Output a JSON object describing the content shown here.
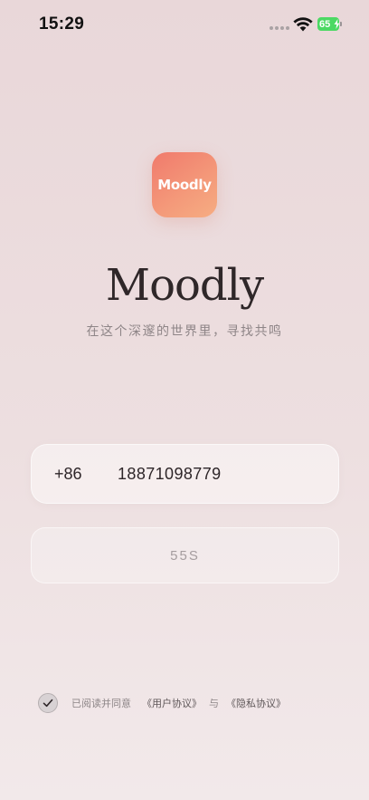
{
  "status_bar": {
    "time": "15:29",
    "battery_level": "65"
  },
  "app": {
    "icon_text": "Moodly",
    "title": "Moodly",
    "slogan": "在这个深邃的世界里，寻找共鸣"
  },
  "login": {
    "country_code": "+86",
    "phone_number": "18871098779",
    "countdown_label": "55S"
  },
  "agreement": {
    "checked": true,
    "prefix": "已阅读并同意",
    "user_agreement": "《用户协议》",
    "connector": "与",
    "privacy_policy": "《隐私协议》"
  },
  "colors": {
    "accent_start": "#f07a6c",
    "accent_end": "#f6ad82",
    "battery_green": "#4cd964"
  },
  "icons": {
    "wifi": "wifi-icon",
    "battery": "battery-icon",
    "check": "check-icon"
  }
}
